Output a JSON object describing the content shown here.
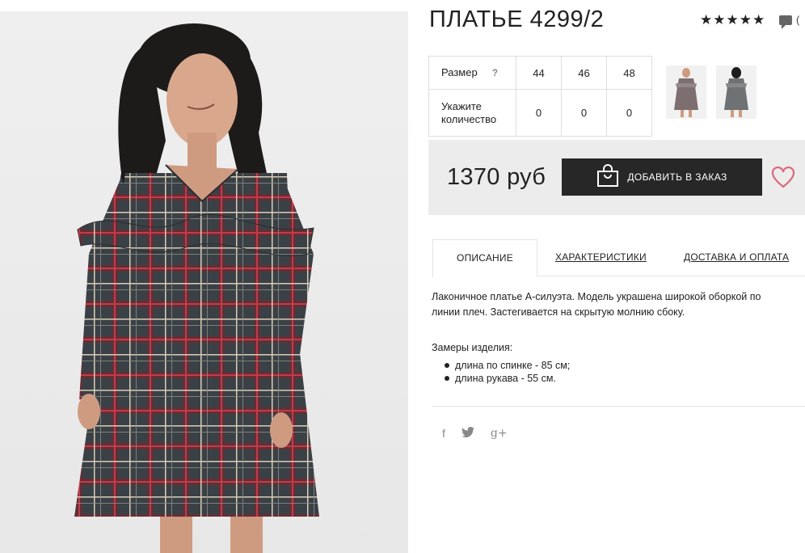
{
  "product": {
    "title": "ПЛАТЬЕ 4299/2",
    "price": "1370 руб",
    "rating_stars": 5,
    "reviews_count": "(",
    "image_alt": "product-photo"
  },
  "size_table": {
    "size_label": "Размер",
    "help": "?",
    "qty_label_line1": "Укажите",
    "qty_label_line2": "количество",
    "sizes": [
      "44",
      "46",
      "48"
    ],
    "quantities": [
      "0",
      "0",
      "0"
    ]
  },
  "buy": {
    "add_label": "ДОБАВИТЬ В ЗАКАЗ"
  },
  "tabs": {
    "description": "ОПИСАНИЕ",
    "characteristics": "ХАРАКТЕРИСТИКИ",
    "delivery": "ДОСТАВКА И ОПЛАТА"
  },
  "description": {
    "text": "Лаконичное платье А-силуэта. Модель украшена широкой оборкой по линии плеч. Застегивается на скрытую молнию сбоку.",
    "measures_title": "Замеры изделия:",
    "measures": [
      "длина по спинке - 85 см;",
      "длина рукава - 55 см."
    ]
  },
  "social": {
    "facebook": "f",
    "twitter": "🐦",
    "google_plus": "g+"
  },
  "colors": {
    "button_bg": "#272727",
    "buybox_bg": "#ececec",
    "heart": "#d96a7d",
    "plaid_base": "#3a4146",
    "plaid_red": "#a8323e"
  }
}
